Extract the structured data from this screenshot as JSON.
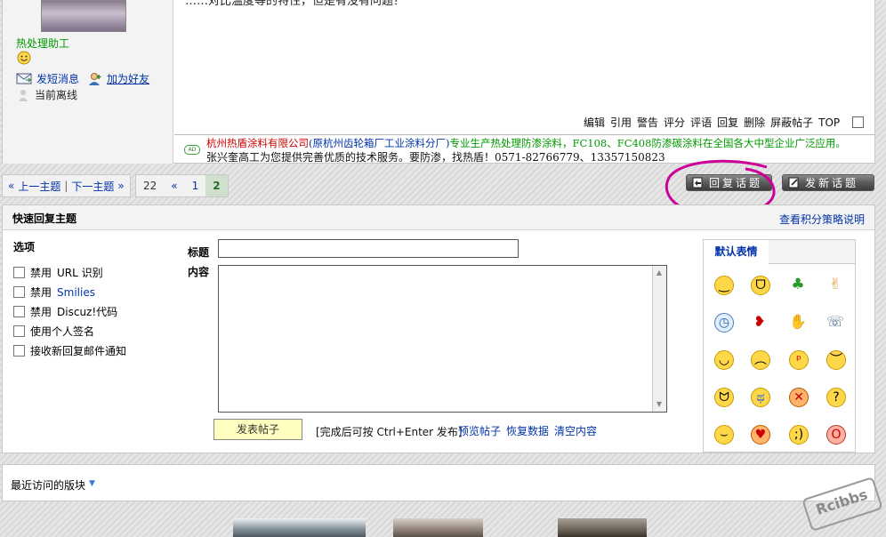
{
  "post": {
    "text_partial": "……对比温度等的特性，但是有没有问题？",
    "user_name": "热处理助工",
    "send_pm": "发短消息",
    "add_friend": "加为好友",
    "status": "当前离线",
    "actions": [
      "编辑",
      "引用",
      "警告",
      "评分",
      "评语",
      "回复",
      "删除",
      "屏蔽帖子",
      "TOP"
    ],
    "ad": {
      "badge": "AD",
      "line1_company": "杭州热盾涂料有限公司",
      "line1_former": "(原杭州齿轮箱厂工业涂料分厂)",
      "line1_desc": "专业生产热处理防渗涂料，FC108、FC408防渗碳涂料在全国各大中型企业广泛应用。",
      "line2": "张兴奎高工为您提供完善优质的技术服务。要防渗，找热盾！0571-82766779、13357150823"
    }
  },
  "nav": {
    "prev": "上一主题",
    "next": "下一主题",
    "pager": [
      "22",
      "«",
      "1",
      "2"
    ],
    "current_page": "2",
    "reply_button": "回复话题",
    "new_button": "发新话题"
  },
  "quick_reply": {
    "title": "快速回复主题",
    "help_link": "查看积分策略说明",
    "options_title": "选项",
    "options": [
      {
        "prefix": "禁用",
        "highlight": "URL 识别"
      },
      {
        "prefix": "禁用",
        "highlight": "Smilies"
      },
      {
        "prefix": "禁用",
        "highlight": "Discuz!代码"
      },
      {
        "prefix": "使用个人签名",
        "highlight": ""
      },
      {
        "prefix": "接收新回复邮件通知",
        "highlight": ""
      }
    ],
    "subject_label": "标题",
    "content_label": "内容",
    "subject_value": "",
    "submit": "发表帖子",
    "hint": "[完成后可按 Ctrl+Enter 发布]",
    "preview": "预览帖子",
    "restore": "恢复数据",
    "clear": "清空内容",
    "smilies_tab": "默认表情"
  },
  "recent": {
    "label": "最近访问的版块"
  },
  "watermark": "Rcibbs",
  "colors": {
    "link": "#0033aa",
    "username": "#009900",
    "ad_company": "#cc0000",
    "ad_desc": "#009900",
    "annotation": "#cc0099"
  }
}
